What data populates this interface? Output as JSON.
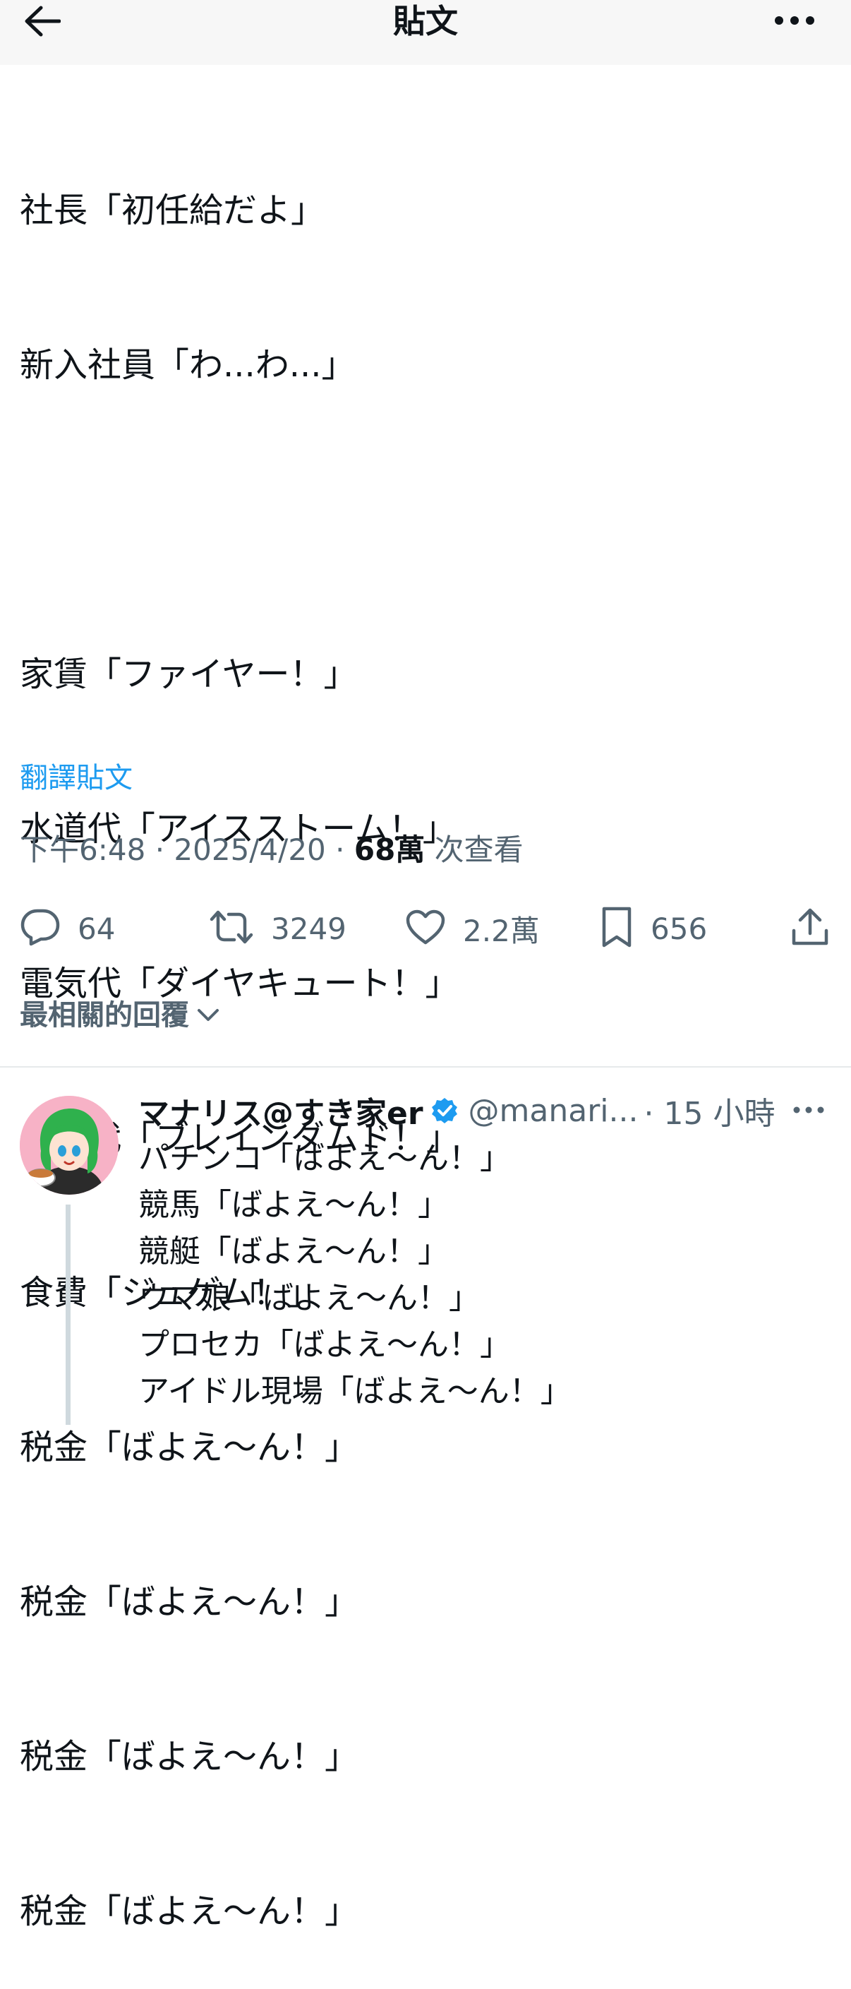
{
  "header": {
    "title": "貼文",
    "back_icon": "arrow-left-icon",
    "more_icon": "ellipsis-icon"
  },
  "tweet": {
    "lines": [
      "社長「初任給だよ」",
      "新入社員「わ...わ...」",
      "",
      "家賃「ファイヤー！」",
      "水道代「アイスストーム！」",
      "電気代「ダイヤキュート！」",
      "ガス代「ブレインダムド！」",
      "食費「ジュゲム！」",
      "税金「ばよえ〜ん！」",
      "税金「ばよえ〜ん！」",
      "税金「ばよえ〜ん！」",
      "税金「ばよえ〜ん！」"
    ],
    "translate_label": "翻譯貼文",
    "time": "下午6:48",
    "date": "2025/4/20",
    "views": "68萬",
    "views_suffix": "次查看",
    "separator": "·"
  },
  "actions": {
    "replies": "64",
    "retweets": "3249",
    "likes": "2.2萬",
    "bookmarks": "656"
  },
  "replies_section": {
    "sort_label": "最相關的回覆"
  },
  "reply": {
    "name": "マナリス@すき家er",
    "handle": "@manari...",
    "time": "· 15 小時",
    "lines": [
      "パチンコ「ばよえ〜ん！」",
      "競馬「ばよえ〜ん！」",
      "競艇「ばよえ〜ん！」",
      "ウマ娘「ばよえ〜ん！」",
      "プロセカ「ばよえ〜ん！」",
      "アイドル現場「ばよえ〜ん！」"
    ]
  },
  "colors": {
    "accent": "#1d9bf0",
    "text": "#0f1419",
    "muted": "#536471"
  }
}
